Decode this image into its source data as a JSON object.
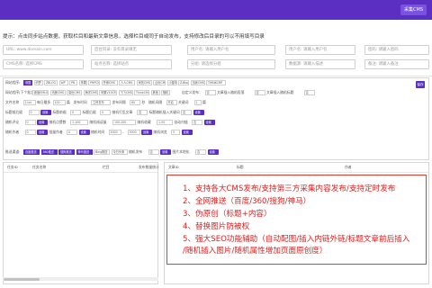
{
  "header": {
    "action_button": "采集CMS"
  },
  "tip": "提示：点击同步站点数据，获取栏目和最新文章信息，选择栏目或同于自动发布，支持修改后目录的可以不用填写目录",
  "inputs": {
    "row1": [
      {
        "placeholder": "URL: www.domain.com"
      },
      {
        "placeholder": "后台目录: 没有目录填无"
      },
      {
        "placeholder": "用户名: 请输入用户名"
      },
      {
        "placeholder": "用户名: 请输入用户名"
      },
      {
        "placeholder": "密码: 请输入密码"
      }
    ],
    "row2": [
      {
        "placeholder": "CMS名称: 选择CMS"
      },
      {
        "placeholder": "站点名称: 选择站点"
      },
      {
        "placeholder": "分组: 请选择分组"
      },
      {
        "placeholder": "数据源: 请输入描述"
      },
      {
        "placeholder": "备注: 请输入备注"
      }
    ]
  },
  "panel": {
    "row1_label": "网站程序:",
    "cms_tabs_1": [
      "帝国",
      "织梦",
      "ZBLOG",
      "WP",
      "PB",
      "苹果",
      "PHPCMS",
      "齐博CMS",
      "人人CMS",
      "米拓CMS",
      "云优CMS",
      "小旋风",
      "Z-Blog",
      "迅睿CMS",
      "THINKCMF"
    ],
    "row2_label": "网站程序(下个批次):",
    "cms_tabs_2": [
      "新版EMLOG",
      "讯美CMS",
      "易优CMS",
      "海洋CMS",
      "苹果V10CMS",
      "飞飞CMS",
      "ThinkCMF",
      "其他",
      "随机"
    ],
    "row2_extra": [
      "自定义发布：",
      "否",
      "文章插入随机段落",
      "否",
      "文章插入随机标题",
      "否"
    ],
    "row3": [
      "文件名称",
      "1.txt",
      "每日最多",
      "100",
      "篇",
      "发布时间",
      "立即发布",
      "发布间隔",
      "60",
      "秒",
      "随机间隔",
      "开启",
      "关键词",
      "1",
      "篇"
    ],
    "row4": [
      "标题前后缀",
      "0",
      "设置",
      "标题前缀",
      "0",
      "标题后缀",
      "0",
      "随机打乱文章",
      "否",
      "标题随机插入关键词",
      "否",
      "设置"
    ],
    "row5": [
      "随机评论",
      "0",
      "设置",
      "随机点赞数",
      "1-100",
      "随机阅读量",
      "100-200",
      "随机收藏",
      "1-50",
      "自动内链",
      "否",
      "设置"
    ],
    "row6": [
      "随机作者",
      "0",
      "设置",
      "批量作者",
      "0",
      "设置",
      "随机时间",
      "2000",
      "-",
      "3000",
      "设置",
      "随机浏览",
      "5",
      "设置"
    ],
    "row7_label": "推送渠道:",
    "row7": [
      "百度推送",
      "360推送",
      "搜狗推送",
      "神马推送",
      "Bing推送",
      "今日头条",
      "随机发布",
      "否",
      "设置",
      "图片本地化",
      "否",
      "设置"
    ],
    "row3_actions": [
      "设置",
      "设置",
      "设置"
    ],
    "submit": "保存"
  },
  "left_table": {
    "headers": [
      "任务ID",
      "任务名称",
      "栏目",
      "发布数量统计"
    ]
  },
  "right_table": {
    "headers": [
      "文章ID",
      "标题",
      "作者"
    ]
  },
  "features": [
    "1、支持各大CMS发布/支持第三方采集内容发布/支持定时发布",
    "2、全网推送（百度/360/搜狗/神马）",
    "3、伪原创（标题+内容）",
    "4、替换图片防被权",
    "5、强大SEO功能辅助（自动配图/插入内链外链/标题文章前后插入",
    "/随机插入图片/随机属性增加页面原创度）"
  ],
  "colors": {
    "accent": "#5a2fc2",
    "feature_red": "#e02020"
  }
}
